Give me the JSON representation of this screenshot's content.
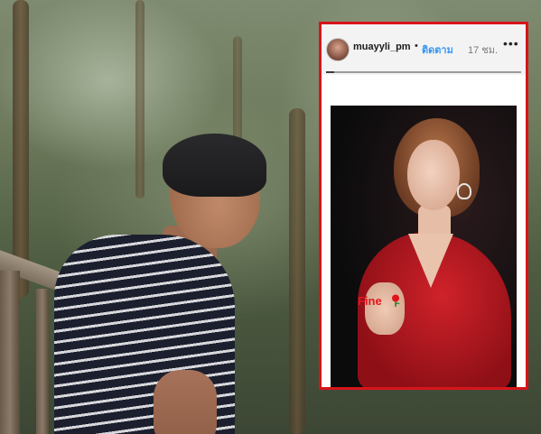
{
  "story": {
    "username": "muayyli_pm",
    "separator": "•",
    "follow_label": "ติดตาม",
    "time": "17 ชม.",
    "more_label": "•••",
    "progress": 0.04,
    "caption": "Fine",
    "caption_icon": "rose-icon"
  },
  "colors": {
    "highlight_border": "#d8141a",
    "follow_blue": "#3897f0",
    "caption_red": "#e8141c"
  }
}
